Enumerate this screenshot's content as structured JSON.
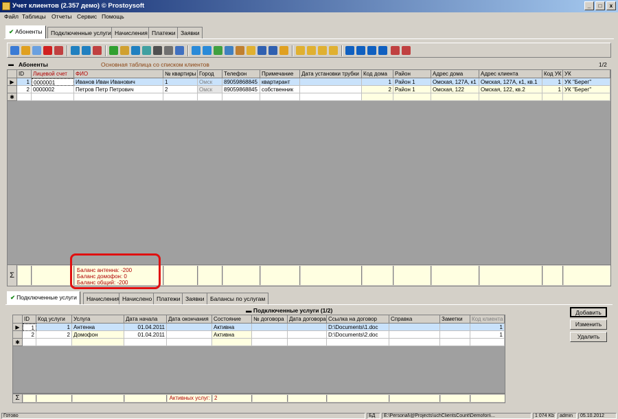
{
  "window": {
    "title": "Учет клиентов (2.357 демо) © Prostoysoft",
    "buttons": [
      "_",
      "□",
      "x"
    ]
  },
  "menu": [
    "Файл",
    "Таблицы",
    "Отчеты",
    "Сервис",
    "Помощь"
  ],
  "main_tabs": [
    "Абоненты",
    "Подключенные услуги",
    "Начисления",
    "Платежи",
    "Заявки"
  ],
  "abonents": {
    "panel_title": "Абоненты",
    "panel_subtitle": "Основная таблица со списком клиентов",
    "page_indicator": "1/2",
    "columns": [
      "ID",
      "Лицевой счет",
      "ФИО",
      "№ квартиры",
      "Город",
      "Телефон",
      "Примечание",
      "Дата установки трубки",
      "Код дома",
      "Район",
      "Адрес дома",
      "Адрес клиента",
      "Код УК",
      "УК"
    ],
    "rows": [
      [
        "1",
        "0000001",
        "Иванов Иван Иванович",
        "1",
        "Омск",
        "89059868845",
        "квартирант",
        "",
        "1",
        "Район 1",
        "Омская, 127А, к1",
        "Омская, 127А, к1, кв.1",
        "1",
        "УК \"Берег\""
      ],
      [
        "2",
        "0000002",
        "Петров Петр Петрович",
        "2",
        "Омск",
        "89059868845",
        "собственник",
        "",
        "2",
        "Район 1",
        "Омская, 122",
        "Омская, 122, кв.2",
        "1",
        "УК \"Берег\""
      ]
    ],
    "summary": {
      "sigma": "Σ",
      "lines": [
        "Баланс антенна: -200",
        "Баланс домофон: 0",
        "Баланс общий: -200"
      ]
    }
  },
  "sub_tabs": [
    "Подключенные услуги",
    "Начисления",
    "Начислено",
    "Платежи",
    "Заявки",
    "Балансы по услугам"
  ],
  "services": {
    "panel_title": "Подключенные услуги (1/2)",
    "columns": [
      "ID",
      "Код услуги",
      "Услуга",
      "Дата начала",
      "Дата окончания",
      "Состояние",
      "№ договора",
      "Дата договора",
      "Ссылка на договор",
      "Справка",
      "Заметки",
      "Код клиента"
    ],
    "rows": [
      [
        "1",
        "1",
        "Антенна",
        "01.04.2011",
        "",
        "Активна",
        "",
        "",
        "D:\\Documents\\1.doc",
        "",
        "",
        "1"
      ],
      [
        "2",
        "2",
        "Домофон",
        "01.04.2011",
        "",
        "Активна",
        "",
        "",
        "D:\\Documents\\2.doc",
        "",
        "",
        "1"
      ]
    ],
    "summary_label": "Активных услуг:",
    "summary_value": "2",
    "sigma": "Σ"
  },
  "side_buttons": {
    "add": "Добавить",
    "edit": "Изменить",
    "delete": "Удалить"
  },
  "statusbar": [
    "Готово",
    "БД",
    "E:\\Personal\\@Projects\\uchClientsCount\\Demofon\\...",
    "1 074 Kb",
    "admin",
    "05.10.2012"
  ]
}
